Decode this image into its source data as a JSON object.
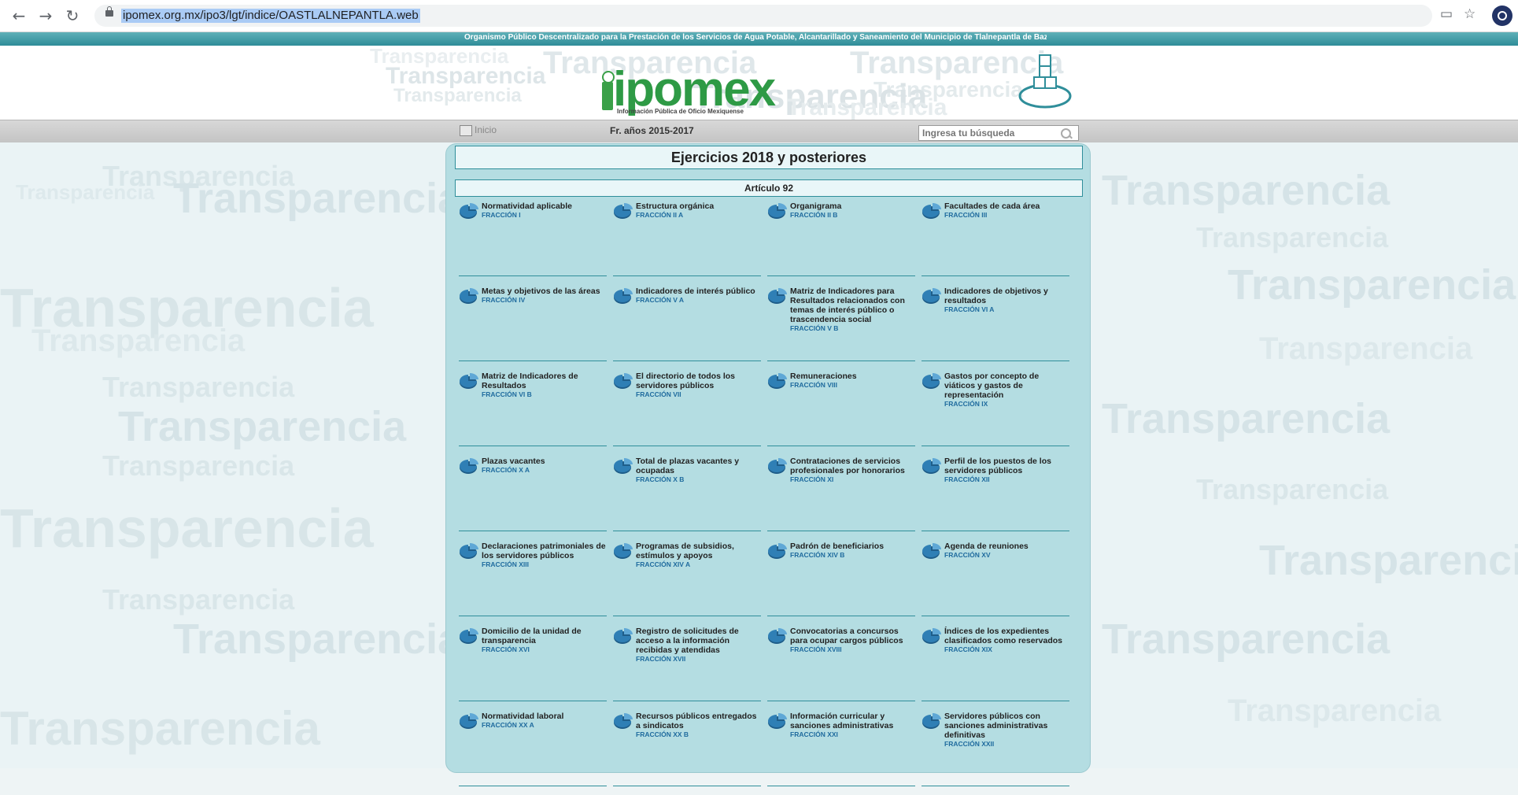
{
  "browser": {
    "url": "ipomex.org.mx/ipo3/lgt/indice/OASTLALNEPANTLA.web"
  },
  "header": {
    "organization": "Organismo Público Descentralizado para la Prestación de los Servicios de Agua Potable, Alcantarillado y Saneamiento del Municipio de Tlalnepantla de Baz",
    "logo_text": "ipomex",
    "logo_subtitle": "Información Pública de Oficio Mexiquense",
    "watermark_word": "Transparencia"
  },
  "navbar": {
    "home_label": "Inicio",
    "years_label": "Fr. años 2015-2017",
    "search_placeholder": "Ingresa tu búsqueda"
  },
  "main": {
    "title": "Ejercicios 2018 y posteriores",
    "article": "Artículo 92",
    "items": [
      {
        "title": "Normatividad aplicable",
        "fraction": "FRACCIÓN I"
      },
      {
        "title": "Estructura orgánica",
        "fraction": "FRACCIÓN II A"
      },
      {
        "title": "Organigrama",
        "fraction": "FRACCIÓN II B"
      },
      {
        "title": "Facultades de cada área",
        "fraction": "FRACCIÓN III"
      },
      {
        "title": "Metas y objetivos de las áreas",
        "fraction": "FRACCIÓN IV"
      },
      {
        "title": "Indicadores de interés público",
        "fraction": "FRACCIÓN V A"
      },
      {
        "title": "Matriz de Indicadores para Resultados relacionados con temas de interés público o trascendencia social",
        "fraction": "FRACCIÓN V B"
      },
      {
        "title": "Indicadores de objetivos y resultados",
        "fraction": "FRACCIÓN VI A"
      },
      {
        "title": "Matriz de Indicadores de Resultados",
        "fraction": "FRACCIÓN VI B"
      },
      {
        "title": "El directorio de todos los servidores públicos",
        "fraction": "FRACCIÓN VII"
      },
      {
        "title": "Remuneraciones",
        "fraction": "FRACCIÓN VIII"
      },
      {
        "title": "Gastos por concepto de viáticos y gastos de representación",
        "fraction": "FRACCIÓN IX"
      },
      {
        "title": "Plazas vacantes",
        "fraction": "FRACCIÓN X A"
      },
      {
        "title": "Total de plazas vacantes y ocupadas",
        "fraction": "FRACCIÓN X B"
      },
      {
        "title": "Contrataciones de servicios profesionales por honorarios",
        "fraction": "FRACCIÓN XI"
      },
      {
        "title": "Perfil de los puestos de los servidores públicos",
        "fraction": "FRACCIÓN XII"
      },
      {
        "title": "Declaraciones patrimoniales de los servidores públicos",
        "fraction": "FRACCIÓN XIII"
      },
      {
        "title": "Programas de subsidios, estímulos y apoyos",
        "fraction": "FRACCIÓN XIV A"
      },
      {
        "title": "Padrón de beneficiarios",
        "fraction": "FRACCIÓN XIV B"
      },
      {
        "title": "Agenda de reuniones",
        "fraction": "FRACCIÓN XV"
      },
      {
        "title": "Domicilio de la unidad de transparencia",
        "fraction": "FRACCIÓN XVI"
      },
      {
        "title": "Registro de solicitudes de acceso a la información recibidas y atendidas",
        "fraction": "FRACCIÓN XVII"
      },
      {
        "title": "Convocatorias a concursos para ocupar cargos públicos",
        "fraction": "FRACCIÓN XVIII"
      },
      {
        "title": "Índices de los expedientes clasificados como reservados",
        "fraction": "FRACCIÓN XIX"
      },
      {
        "title": "Normatividad laboral",
        "fraction": "FRACCIÓN XX A"
      },
      {
        "title": "Recursos públicos entregados a sindicatos",
        "fraction": "FRACCIÓN XX B"
      },
      {
        "title": "Información curricular y sanciones administrativas",
        "fraction": "FRACCIÓN XXI"
      },
      {
        "title": "Servidores públicos con sanciones administrativas definitivas",
        "fraction": "FRACCIÓN XXII"
      }
    ]
  },
  "colors": {
    "accent_teal": "#2f8e9a",
    "panel_bg": "#b4dde2",
    "fraction_blue": "#1f6b9e",
    "logo_green": "#2e9a45"
  }
}
